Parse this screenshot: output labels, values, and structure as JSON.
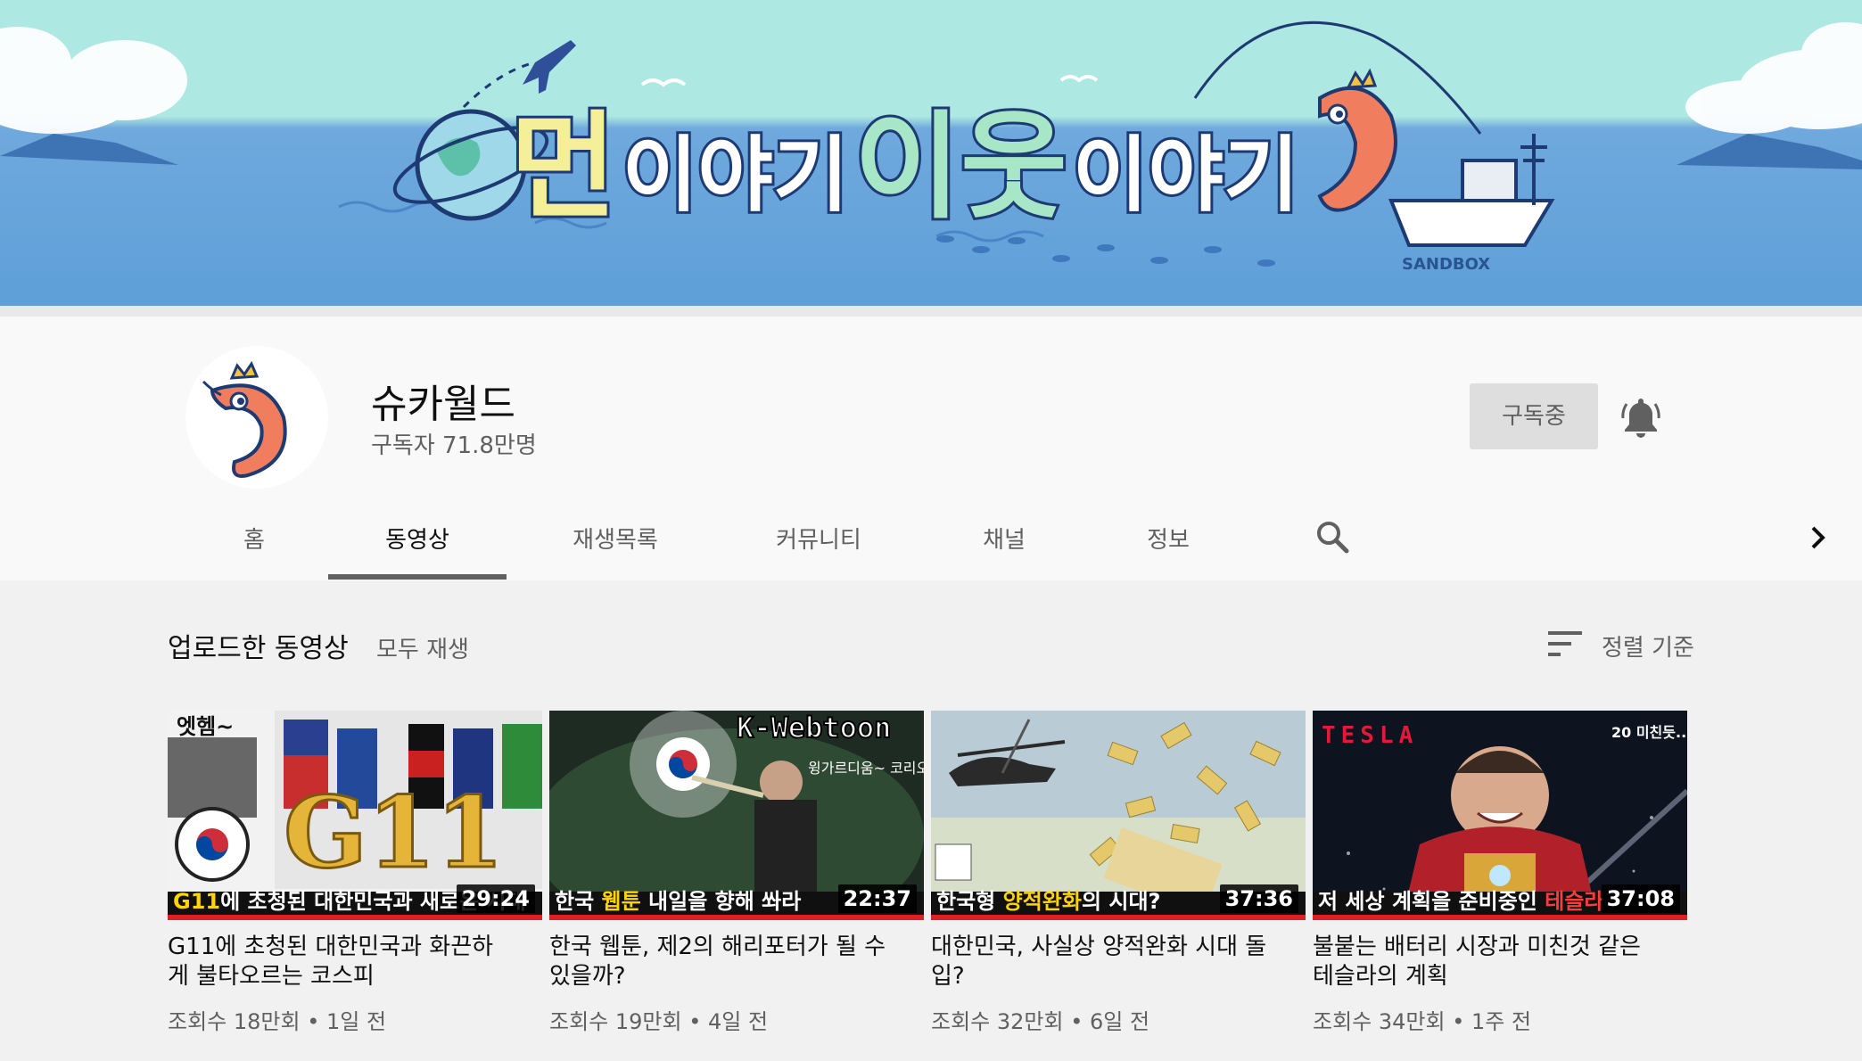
{
  "banner": {
    "title_part1": "먼",
    "title_part2": "이야기",
    "title_part3": "이웃",
    "title_part4": "이야기",
    "sandbox_label": "SANDBOX",
    "colors": {
      "sky": "#aee8e2",
      "sea": "#5e9fd8",
      "title_yellow": "#f6ef9a",
      "title_mint": "#a8e6c8",
      "title_outline": "#1e3a73",
      "shrimp": "#f07e5e"
    }
  },
  "channel": {
    "name": "슈카월드",
    "subscribers": "구독자 71.8만명",
    "subscribed_label": "구독중"
  },
  "tabs": [
    {
      "label": "홈",
      "active": false
    },
    {
      "label": "동영상",
      "active": true
    },
    {
      "label": "재생목록",
      "active": false
    },
    {
      "label": "커뮤니티",
      "active": false
    },
    {
      "label": "채널",
      "active": false
    },
    {
      "label": "정보",
      "active": false
    }
  ],
  "icons": {
    "search": "search-icon",
    "chevron": "chevron-right-icon",
    "bell": "bell-icon",
    "sort": "sort-icon"
  },
  "uploads": {
    "title": "업로드한 동영상",
    "play_all": "모두 재생",
    "sort_label": "정렬 기준"
  },
  "videos": [
    {
      "title": "G11에 초청된 대한민국과 화끈하게 불타오르는 코스피",
      "meta": "조회수 18만회 • 1일 전",
      "duration": "29:24",
      "caption_hl": "G11",
      "caption_rest": "에 초청된 대한민국과 새로운 시대",
      "thumb_text": "G11",
      "thumb_sticker": "엣헴~"
    },
    {
      "title": "한국 웹툰, 제2의 해리포터가 될 수 있을까?",
      "meta": "조회수 19만회 • 4일 전",
      "duration": "22:37",
      "caption_pre": "한국 ",
      "caption_hl": "웹툰",
      "caption_rest": " 내일을 향해 쏴라",
      "thumb_text": "K-Webtoon",
      "thumb_sticker": "윙가르디움~ 코리오우싸~"
    },
    {
      "title": "대한민국, 사실상 양적완화 시대 돌입?",
      "meta": "조회수 32만회 • 6일 전",
      "duration": "37:36",
      "caption_pre": "한국형 ",
      "caption_hl": "양적완화",
      "caption_rest": "의 시대?"
    },
    {
      "title": "불붙는 배터리 시장과 미친것 같은 테슬라의 계획",
      "meta": "조회수 34만회 • 1주 전",
      "duration": "37:08",
      "caption_pre": "저 세상 계획을 준비중인 ",
      "caption_hl": "테슬라",
      "thumb_text": "TESLA",
      "thumb_sticker": "20 미친듯.."
    }
  ]
}
